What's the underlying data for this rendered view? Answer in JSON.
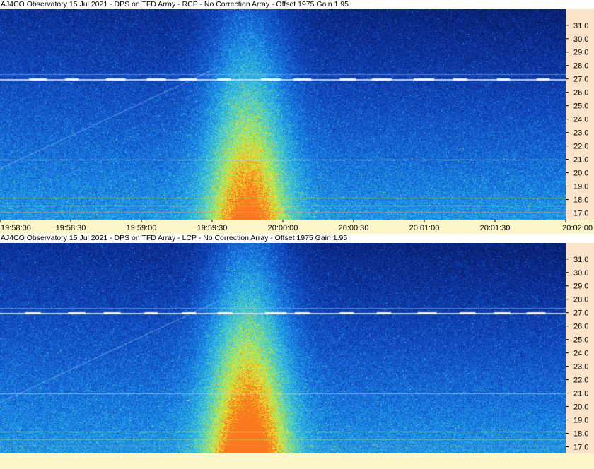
{
  "chart_data": [
    {
      "type": "heatmap",
      "title": "AJ4CO Observatory 15 Jul 2021 - DPS on TFD Array  - RCP  -  No Correction Array  -  Offset 1975  Gain 1.95",
      "x": [
        "19:58:00",
        "19:58:30",
        "19:59:00",
        "19:59:30",
        "20:00:00",
        "20:00:30",
        "20:01:00",
        "20:01:30",
        "20:02:00"
      ],
      "y": [
        31.0,
        30.0,
        29.0,
        28.0,
        27.0,
        26.0,
        25.0,
        24.0,
        23.0,
        22.0,
        21.0,
        20.0,
        19.0,
        18.0,
        17.0
      ],
      "y_tick_labels": [
        "31.0",
        "30.0",
        "29.0",
        "28.0",
        "27.0",
        "26.0",
        "25.0",
        "24.0",
        "23.0",
        "22.0",
        "21.0",
        "20.0",
        "19.0",
        "18.0",
        "17.0"
      ],
      "xlim": [
        "19:58:00",
        "20:02:00"
      ],
      "ylim": [
        16.5,
        32.2
      ],
      "burst_intensity": 0.85
    },
    {
      "type": "heatmap",
      "title": "AJ4CO Observatory 15 Jul 2021 - DPS on TFD Array  - LCP  -  No Correction Array  -  Offset 1975  Gain 1.95",
      "x": [],
      "y": [
        31.0,
        30.0,
        29.0,
        28.0,
        27.0,
        26.0,
        25.0,
        24.0,
        23.0,
        22.0,
        21.0,
        20.0,
        19.0,
        18.0,
        17.0
      ],
      "y_tick_labels": [
        "31.0",
        "30.0",
        "29.0",
        "28.0",
        "27.0",
        "26.0",
        "25.0",
        "24.0",
        "23.0",
        "22.0",
        "21.0",
        "20.0",
        "19.0",
        "18.0",
        "17.0"
      ],
      "xlim": [
        "19:58:00",
        "20:02:00"
      ],
      "ylim": [
        16.5,
        32.2
      ],
      "burst_intensity": 1.0
    }
  ]
}
